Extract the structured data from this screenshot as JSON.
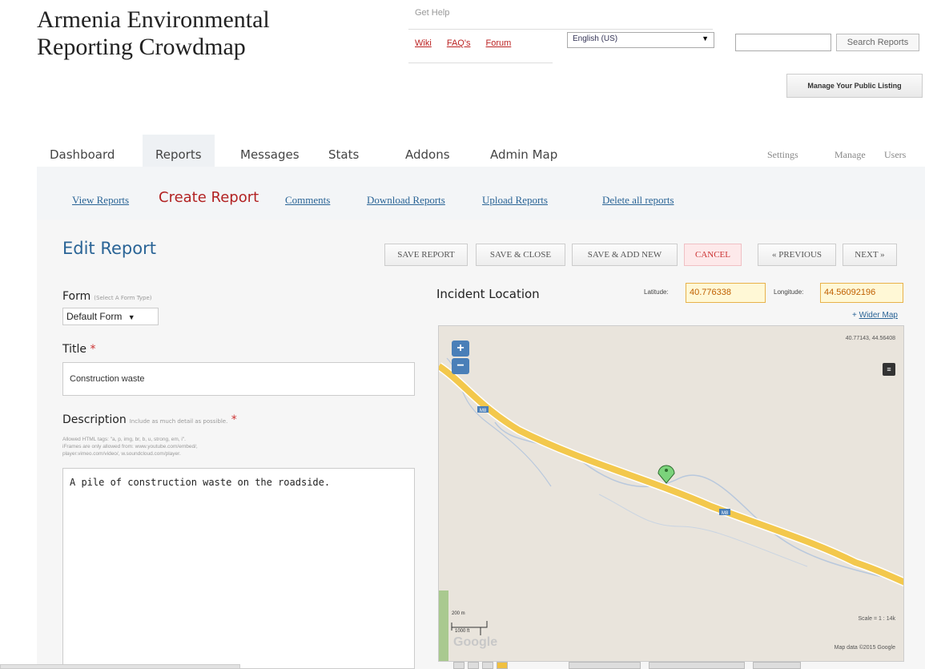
{
  "site": {
    "title_line1": "Armenia Environmental",
    "title_line2": "Reporting Crowdmap"
  },
  "help": {
    "label": "Get Help",
    "links": [
      "Wiki",
      "FAQ's",
      "Forum"
    ],
    "language": "English (US)",
    "search_placeholder": "",
    "search_button": "Search Reports",
    "manage_listing": "Manage Your Public Listing"
  },
  "tabs": [
    "Dashboard",
    "Reports",
    "Messages",
    "Stats",
    "Addons",
    "Admin Map"
  ],
  "active_tab": "Reports",
  "right_links": [
    "Settings",
    "Manage",
    "Users"
  ],
  "subnav": {
    "view_reports": "View Reports",
    "create_report": "Create Report",
    "comments": "Comments",
    "download_reports": "Download Reports",
    "upload_reports": "Upload Reports",
    "delete_all": "Delete all reports"
  },
  "page_title": "Edit Report",
  "buttons": {
    "save_report": "SAVE REPORT",
    "save_close": "SAVE & CLOSE",
    "save_add_new": "SAVE & ADD NEW",
    "cancel": "CANCEL",
    "previous": "« PREVIOUS",
    "next": "NEXT »"
  },
  "form": {
    "label": "Form",
    "hint": "(Select A Form Type)",
    "selected": "Default Form"
  },
  "title_field": {
    "label": "Title",
    "required_mark": "*",
    "value": "Construction waste"
  },
  "description_field": {
    "label": "Description",
    "hint": "Include as much detail as possible.",
    "required_mark": "*",
    "note_line1": "Allowed HTML tags: \"a, p, img, br, b, u, strong, em, i\".",
    "note_line2": "iFrames are only allowed from: www.youtube.com/embed/,",
    "note_line3": "player.vimeo.com/video/, w.soundcloud.com/player.",
    "value": "A pile of construction waste on the roadside."
  },
  "location": {
    "label": "Incident Location",
    "lat_label": "Latitude:",
    "lat_value": "40.776338",
    "lon_label": "Longitude:",
    "lon_value": "44.56092196",
    "wider_map": "Wider Map",
    "map_coords": "40.77143, 44.56408",
    "road_label": "M8",
    "scale_text": "Scale = 1 : 14k",
    "map_data": "Map data ©2015 Google",
    "scale_m": "200 m",
    "scale_ft": "1000 ft",
    "google_logo": "Google"
  },
  "colors": {
    "link": "#2a6496",
    "create_report": "#b22222",
    "road": "#f3c84c",
    "river": "#9db4d6",
    "marker": "#7bd37b",
    "zoom": "#4a7fb8"
  }
}
